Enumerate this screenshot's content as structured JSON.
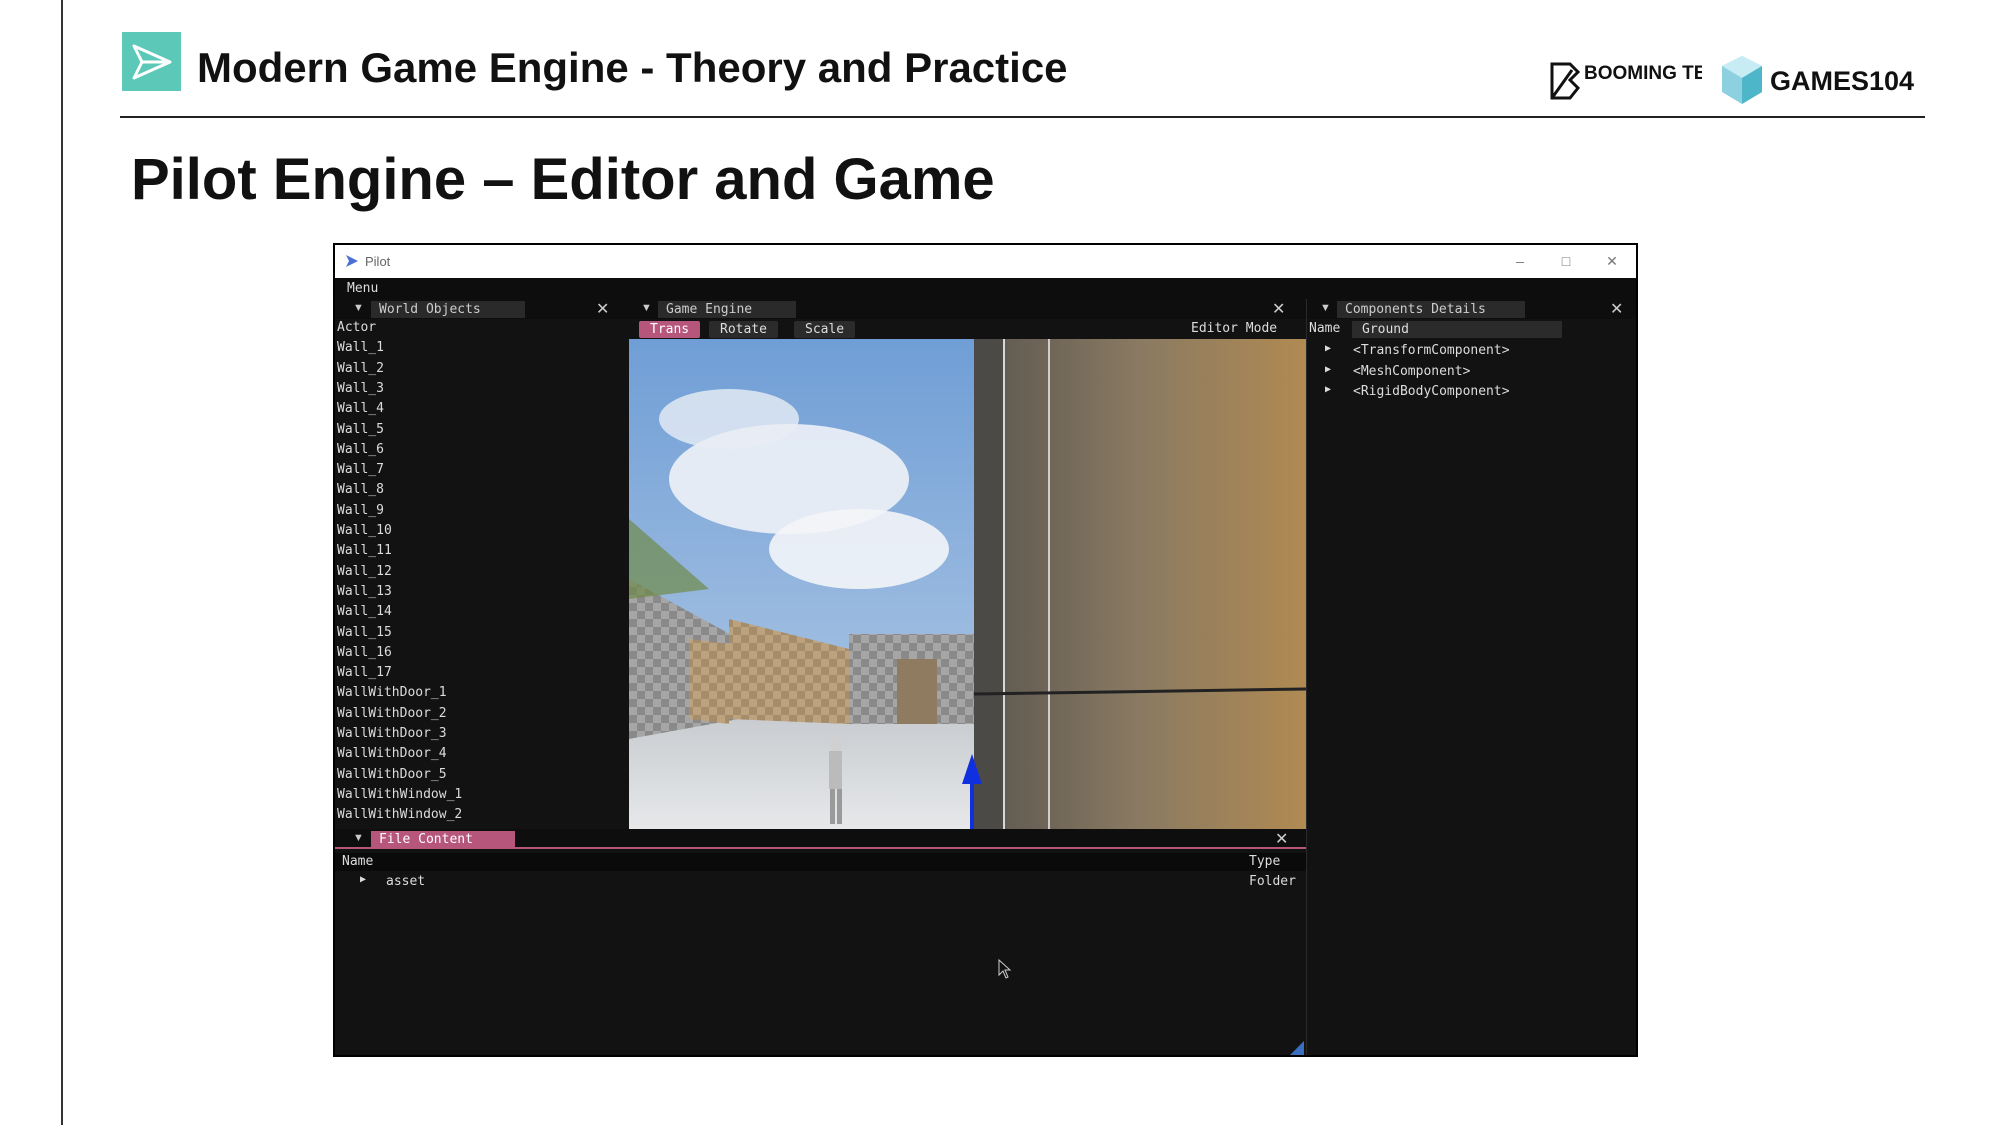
{
  "slide": {
    "header_title": "Modern Game Engine - Theory and Practice",
    "title": "Pilot Engine – Editor and Game",
    "logos": [
      "BOOMING TECH",
      "GAMES104"
    ]
  },
  "window": {
    "title": "Pilot",
    "controls": [
      "–",
      "□",
      "✕"
    ]
  },
  "menu": {
    "label": "Menu"
  },
  "world_objects": {
    "tab_label": "World Objects",
    "items": [
      "Actor",
      "Wall_1",
      "Wall_2",
      "Wall_3",
      "Wall_4",
      "Wall_5",
      "Wall_6",
      "Wall_7",
      "Wall_8",
      "Wall_9",
      "Wall_10",
      "Wall_11",
      "Wall_12",
      "Wall_13",
      "Wall_14",
      "Wall_15",
      "Wall_16",
      "Wall_17",
      "WallWithDoor_1",
      "WallWithDoor_2",
      "WallWithDoor_3",
      "WallWithDoor_4",
      "WallWithDoor_5",
      "WallWithWindow_1",
      "WallWithWindow_2"
    ]
  },
  "game_engine": {
    "tab_label": "Game Engine",
    "tools": [
      "Trans",
      "Rotate",
      "Scale"
    ],
    "active_tool": "Trans",
    "mode_label": "Editor Mode"
  },
  "components": {
    "tab_label": "Components Details",
    "name_label": "Name",
    "name_value": "Ground",
    "items": [
      "<TransformComponent>",
      "<MeshComponent>",
      "<RigidBodyComponent>"
    ]
  },
  "file_content": {
    "tab_label": "File Content",
    "col_name": "Name",
    "col_type": "Type",
    "rows": [
      {
        "name": "asset",
        "type": "Folder"
      }
    ]
  },
  "colors": {
    "accent": "#b5567a",
    "panel_bg": "#121212",
    "logo_teal": "#5cc8b8"
  }
}
